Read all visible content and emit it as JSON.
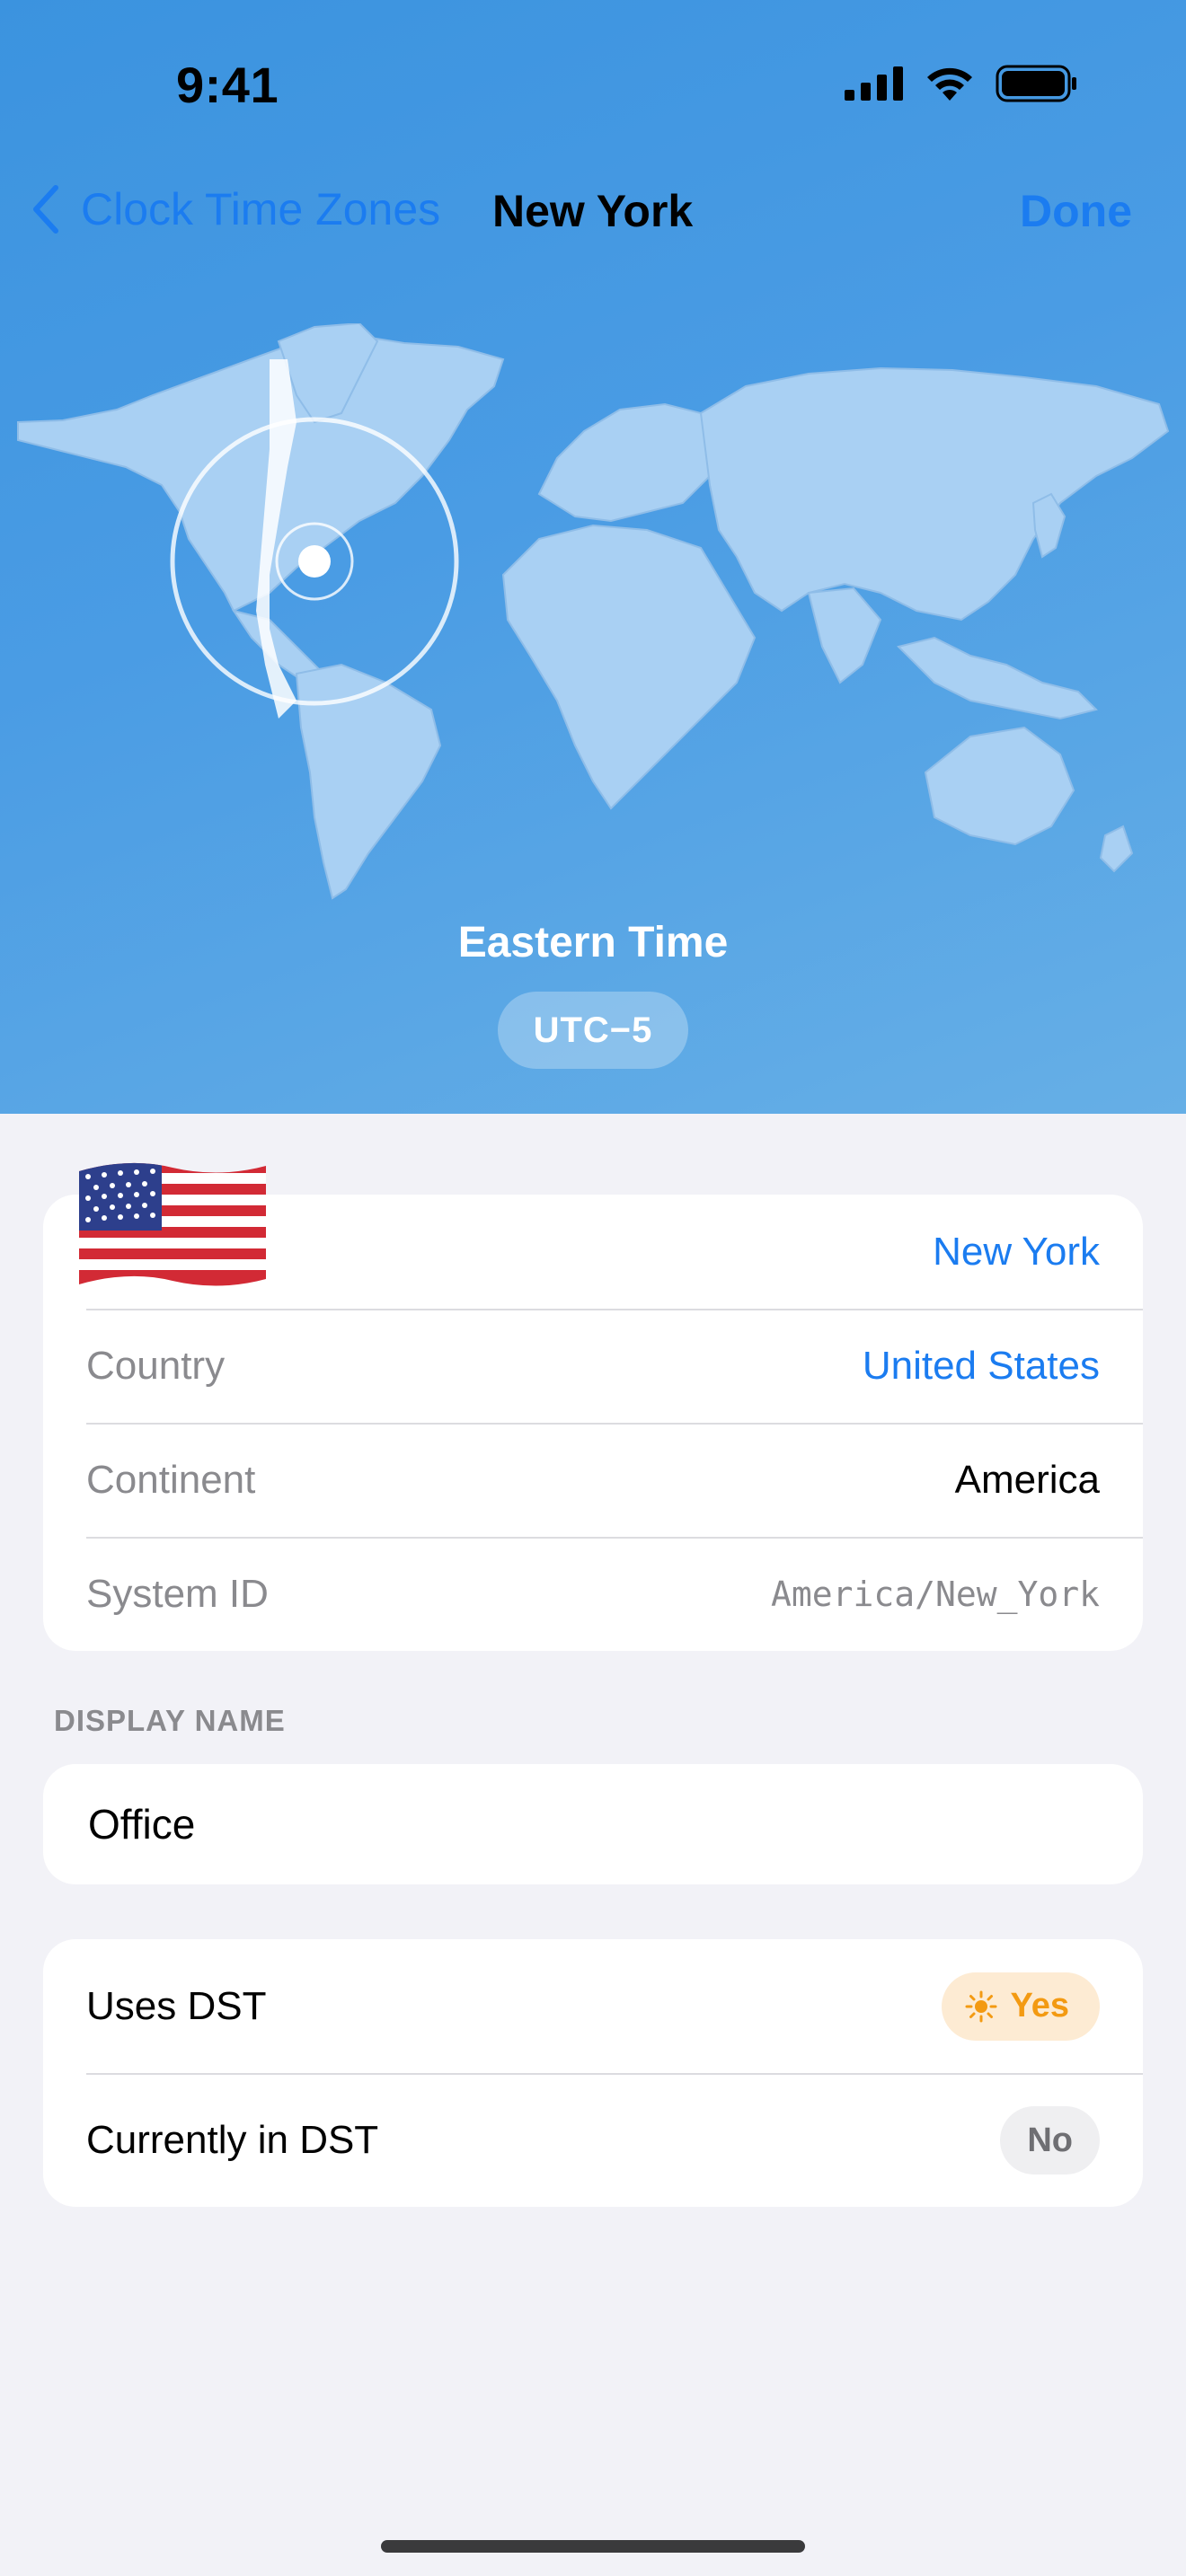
{
  "status_bar": {
    "time": "9:41"
  },
  "nav": {
    "back_label": "Clock Time Zones",
    "title": "New York",
    "done_label": "Done"
  },
  "hero": {
    "zone_name": "Eastern Time",
    "utc_offset": "UTC−5"
  },
  "details": {
    "city": "New York",
    "country_label": "Country",
    "country_value": "United States",
    "continent_label": "Continent",
    "continent_value": "America",
    "system_id_label": "System ID",
    "system_id_value": "America/New_York"
  },
  "display_name": {
    "section_header": "DISPLAY NAME",
    "value": "Office"
  },
  "dst": {
    "uses_label": "Uses DST",
    "uses_value": "Yes",
    "current_label": "Currently in DST",
    "current_value": "No"
  },
  "colors": {
    "accent": "#1b7cf0",
    "hero_top": "#3b93df",
    "hero_bottom": "#66afe6",
    "dst_yes_bg": "#fdebd3",
    "dst_yes_fg": "#f39a12"
  },
  "icons": {
    "back": "chevron-left-icon",
    "flag": "us-flag-icon",
    "sun": "sun-icon",
    "location": "location-marker-icon"
  }
}
